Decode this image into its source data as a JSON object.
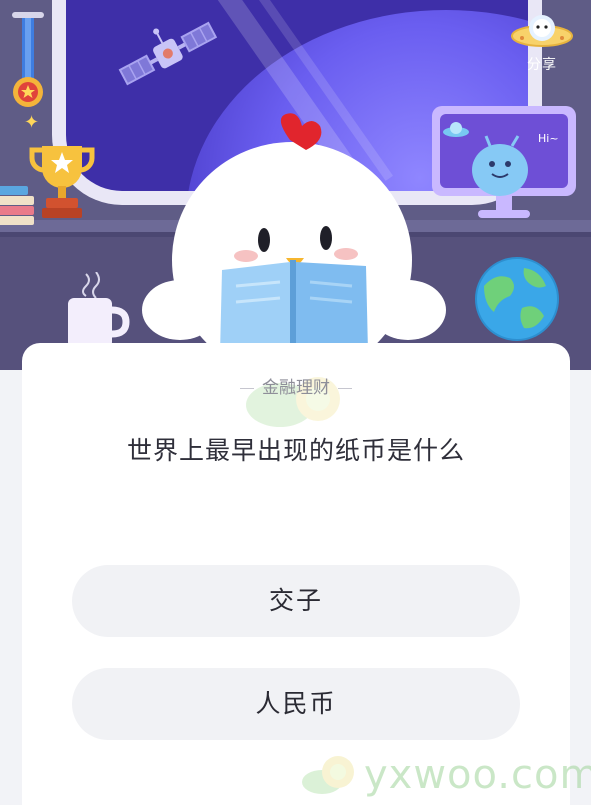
{
  "header": {
    "share_label": "分享",
    "monitor_greeting": "Hi~"
  },
  "quiz": {
    "category": "金融理财",
    "question": "世界上最早出现的纸币是什么",
    "options": [
      {
        "label": "交子"
      },
      {
        "label": "人民币"
      }
    ]
  },
  "watermark": {
    "text": "yxwoo.com"
  },
  "colors": {
    "card_background": "#ffffff",
    "option_background": "#f1f2f5",
    "window_blue": "#3e2fa8",
    "header_background": "#5f5c86"
  }
}
